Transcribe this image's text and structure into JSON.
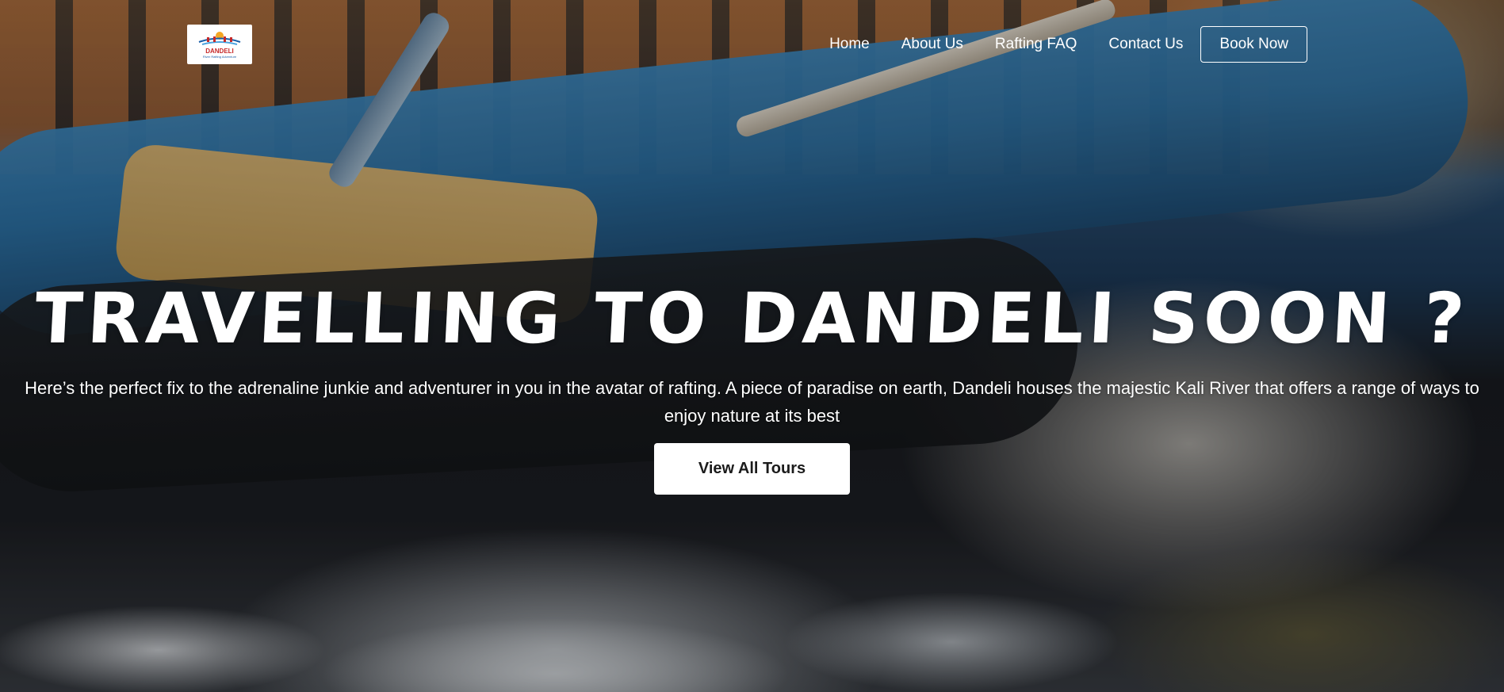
{
  "header": {
    "logo": {
      "text": "DANDELI",
      "subtext": "River Rafting Adventure"
    },
    "nav": {
      "items": [
        {
          "label": "Home"
        },
        {
          "label": "About Us"
        },
        {
          "label": "Rafting FAQ"
        },
        {
          "label": "Contact Us"
        }
      ],
      "book_label": "Book Now"
    }
  },
  "hero": {
    "title": "Travelling to Dandeli soon ?",
    "description": "Here’s the perfect fix to the adrenaline junkie and adventurer in you in the avatar of rafting. A piece of paradise on earth, Dandeli houses the majestic Kali River that offers a range of ways to enjoy nature at its best",
    "cta_label": "View All Tours",
    "background_image": "rafting-photo"
  },
  "colors": {
    "text": "#ffffff",
    "button_bg": "#ffffff",
    "button_text": "#1b1b1b",
    "logo_red": "#c62828",
    "logo_blue": "#1a5fa8"
  }
}
